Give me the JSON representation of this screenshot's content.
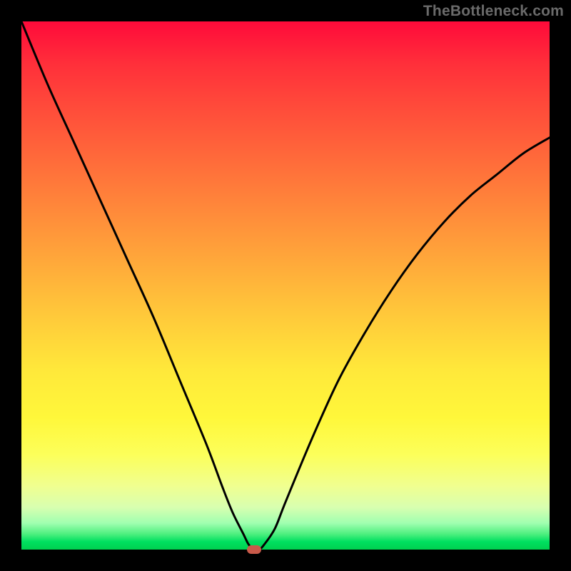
{
  "attribution": "TheBottleneck.com",
  "chart_data": {
    "type": "line",
    "title": "",
    "xlabel": "",
    "ylabel": "",
    "xlim": [
      0,
      100
    ],
    "ylim": [
      0,
      100
    ],
    "series": [
      {
        "name": "bottleneck-curve",
        "x": [
          0,
          5,
          10,
          15,
          20,
          25,
          30,
          35,
          38,
          40,
          42,
          43,
          44,
          45,
          46,
          48,
          50,
          55,
          60,
          65,
          70,
          75,
          80,
          85,
          90,
          95,
          100
        ],
        "y": [
          100,
          88,
          77,
          66,
          55,
          44,
          32,
          20,
          12,
          7,
          3,
          1,
          0,
          0,
          1,
          4,
          9,
          21,
          32,
          41,
          49,
          56,
          62,
          67,
          71,
          75,
          78
        ]
      }
    ],
    "marker": {
      "x": 44,
      "y": 0,
      "color": "#c95a4a"
    },
    "background_gradient": {
      "top": "#ff0a3a",
      "mid": "#ffe83a",
      "bottom": "#00d050"
    }
  }
}
